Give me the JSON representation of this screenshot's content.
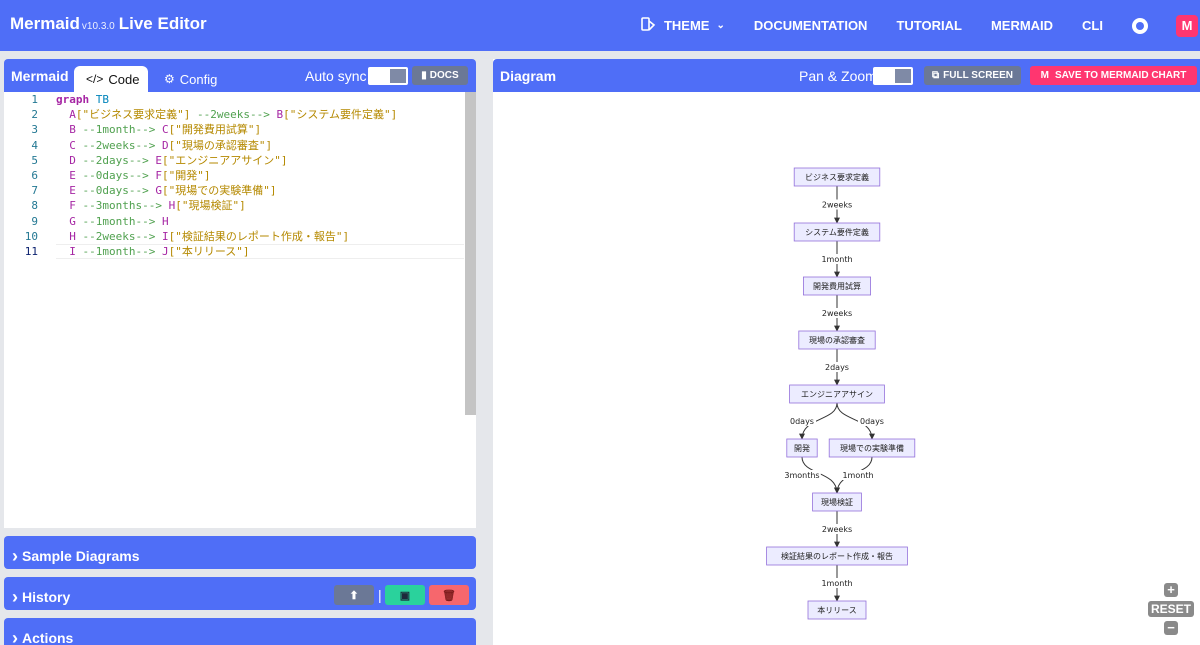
{
  "app": {
    "name": "Mermaid",
    "version": "v10.3.0",
    "title_suffix": "Live Editor"
  },
  "nav": {
    "theme": "THEME",
    "documentation": "DOCUMENTATION",
    "tutorial": "TUTORIAL",
    "mermaid": "MERMAID",
    "cli": "CLI"
  },
  "editor": {
    "title": "Mermaid",
    "tab_code": "Code",
    "tab_config": "Config",
    "autosync_label": "Auto sync",
    "docs_label": "DOCS",
    "line_numbers": [
      "1",
      "2",
      "3",
      "4",
      "5",
      "6",
      "7",
      "8",
      "9",
      "10",
      "11"
    ],
    "code": [
      [
        {
          "t": "graph",
          "c": "kw"
        },
        {
          "t": " TB",
          "c": "dir"
        }
      ],
      [
        {
          "t": "  A",
          "c": "id"
        },
        {
          "t": "[\"ビジネス要求定義\"]",
          "c": "str"
        },
        {
          "t": " --2weeks-->",
          "c": "arr"
        },
        {
          "t": " B",
          "c": "id"
        },
        {
          "t": "[\"システム要件定義\"]",
          "c": "str"
        }
      ],
      [
        {
          "t": "  B",
          "c": "id"
        },
        {
          "t": " --1month-->",
          "c": "arr"
        },
        {
          "t": " C",
          "c": "id"
        },
        {
          "t": "[\"開発費用試算\"]",
          "c": "str"
        }
      ],
      [
        {
          "t": "  C",
          "c": "id"
        },
        {
          "t": " --2weeks-->",
          "c": "arr"
        },
        {
          "t": " D",
          "c": "id"
        },
        {
          "t": "[\"現場の承認審査\"]",
          "c": "str"
        }
      ],
      [
        {
          "t": "  D",
          "c": "id"
        },
        {
          "t": " --2days-->",
          "c": "arr"
        },
        {
          "t": " E",
          "c": "id"
        },
        {
          "t": "[\"エンジニアアサイン\"]",
          "c": "str"
        }
      ],
      [
        {
          "t": "  E",
          "c": "id"
        },
        {
          "t": " --0days-->",
          "c": "arr"
        },
        {
          "t": " F",
          "c": "id"
        },
        {
          "t": "[\"開発\"]",
          "c": "str"
        }
      ],
      [
        {
          "t": "  E",
          "c": "id"
        },
        {
          "t": " --0days-->",
          "c": "arr"
        },
        {
          "t": " G",
          "c": "id"
        },
        {
          "t": "[\"現場での実験準備\"]",
          "c": "str"
        }
      ],
      [
        {
          "t": "  F",
          "c": "id"
        },
        {
          "t": " --3months-->",
          "c": "arr"
        },
        {
          "t": " H",
          "c": "id"
        },
        {
          "t": "[\"現場検証\"]",
          "c": "str"
        }
      ],
      [
        {
          "t": "  G",
          "c": "id"
        },
        {
          "t": " --1month-->",
          "c": "arr"
        },
        {
          "t": " H",
          "c": "id"
        }
      ],
      [
        {
          "t": "  H",
          "c": "id"
        },
        {
          "t": " --2weeks-->",
          "c": "arr"
        },
        {
          "t": " I",
          "c": "id"
        },
        {
          "t": "[\"検証結果のレポート作成・報告\"]",
          "c": "str"
        }
      ],
      [
        {
          "t": "  I",
          "c": "id"
        },
        {
          "t": " --1month-->",
          "c": "arr"
        },
        {
          "t": " J",
          "c": "id"
        },
        {
          "t": "[\"本リリース\"]",
          "c": "str"
        }
      ]
    ],
    "active_line": 10
  },
  "sections": {
    "samples": "Sample Diagrams",
    "history": "History",
    "actions": "Actions"
  },
  "history": {
    "upload_icon": "upload-icon",
    "save_icon": "save-icon",
    "delete_icon": "trash-icon"
  },
  "diagram": {
    "title": "Diagram",
    "panzoom_label": "Pan & Zoom",
    "fullscreen_label": "FULL SCREEN",
    "save_chart_label": "SAVE TO MERMAID CHART",
    "reset_label": "RESET",
    "nodes": {
      "A": "ビジネス要求定義",
      "B": "システム要件定義",
      "C": "開発費用試算",
      "D": "現場の承認審査",
      "E": "エンジニアアサイン",
      "F": "開発",
      "G": "現場での実験準備",
      "H": "現場検証",
      "I": "検証結果のレポート作成・報告",
      "J": "本リリース"
    },
    "edges": [
      {
        "from": "A",
        "to": "B",
        "label": "2weeks"
      },
      {
        "from": "B",
        "to": "C",
        "label": "1month"
      },
      {
        "from": "C",
        "to": "D",
        "label": "2weeks"
      },
      {
        "from": "D",
        "to": "E",
        "label": "2days"
      },
      {
        "from": "E",
        "to": "F",
        "label": "0days"
      },
      {
        "from": "E",
        "to": "G",
        "label": "0days"
      },
      {
        "from": "F",
        "to": "H",
        "label": "3months"
      },
      {
        "from": "G",
        "to": "H",
        "label": "1month"
      },
      {
        "from": "H",
        "to": "I",
        "label": "2weeks"
      },
      {
        "from": "I",
        "to": "J",
        "label": "1month"
      }
    ]
  },
  "colors": {
    "primary": "#4f6ef7",
    "node_fill": "#ececff",
    "node_stroke": "#9370db",
    "danger": "#f6676d",
    "success": "#2ad29c",
    "brand_pink": "#ff3670"
  }
}
